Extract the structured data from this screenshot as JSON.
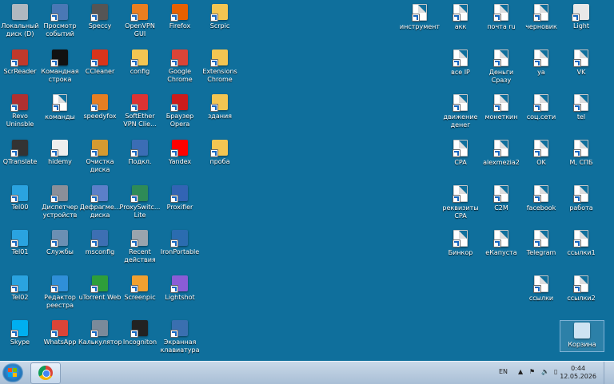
{
  "desktop": {
    "icons": [
      {
        "label": "Локальный диск (D)",
        "icon": "drive-icon",
        "color": "#b0b8c0"
      },
      {
        "label": "Просмотр событий",
        "icon": "event-viewer-icon",
        "color": "#4a78b5"
      },
      {
        "label": "Speccy",
        "icon": "speccy-icon",
        "color": "#555555"
      },
      {
        "label": "OpenVPN GUI",
        "icon": "openvpn-icon",
        "color": "#ea7e20"
      },
      {
        "label": "Firefox",
        "icon": "firefox-icon",
        "color": "#e66000"
      },
      {
        "label": "Scrpic",
        "icon": "folder-icon",
        "color": "#f3c552"
      },
      {
        "label": "ScrReader",
        "icon": "scrreader-icon",
        "color": "#c0392b"
      },
      {
        "label": "Командная строка",
        "icon": "cmd-icon",
        "color": "#111111"
      },
      {
        "label": "CCleaner",
        "icon": "ccleaner-icon",
        "color": "#d9341b"
      },
      {
        "label": "config",
        "icon": "folder-icon",
        "color": "#f3c552"
      },
      {
        "label": "Google Chrome",
        "icon": "chrome-icon",
        "color": "#db4437"
      },
      {
        "label": "Extensions Chrome",
        "icon": "folder-icon",
        "color": "#f3c552"
      },
      {
        "label": "Revo Uninsble",
        "icon": "revo-icon",
        "color": "#b03030"
      },
      {
        "label": "команды",
        "icon": "file-icon",
        "color": "#ffffff"
      },
      {
        "label": "speedyfox",
        "icon": "speedyfox-icon",
        "color": "#e67e22"
      },
      {
        "label": "SoftEther VPN Clie...",
        "icon": "softether-icon",
        "color": "#d33"
      },
      {
        "label": "Браузер Opera",
        "icon": "opera-icon",
        "color": "#cc1b1b"
      },
      {
        "label": "здания",
        "icon": "folder-icon",
        "color": "#f3c552"
      },
      {
        "label": "QTranslate",
        "icon": "qtranslate-icon",
        "color": "#333333"
      },
      {
        "label": "hidemy",
        "icon": "hidemy-icon",
        "color": "#eeeeee"
      },
      {
        "label": "Очистка диска",
        "icon": "disk-cleanup-icon",
        "color": "#d49a30"
      },
      {
        "label": "Подкл.",
        "icon": "network-icon",
        "color": "#3b6db5"
      },
      {
        "label": "Yandex",
        "icon": "yandex-icon",
        "color": "#ff0000"
      },
      {
        "label": "проба",
        "icon": "folder-icon",
        "color": "#f3c552"
      },
      {
        "label": "Tel00",
        "icon": "telegram-icon",
        "color": "#2aa3e0"
      },
      {
        "label": "Диспетчер устройств",
        "icon": "device-manager-icon",
        "color": "#8a8f99"
      },
      {
        "label": "Дефрагме... диска",
        "icon": "defrag-icon",
        "color": "#5b7fc9"
      },
      {
        "label": "ProxySwitc... Lite",
        "icon": "proxyswitcher-icon",
        "color": "#2e8b57"
      },
      {
        "label": "Proxifier",
        "icon": "proxifier-icon",
        "color": "#3264b4"
      },
      {
        "label": "Tel01",
        "icon": "telegram-icon",
        "color": "#2aa3e0"
      },
      {
        "label": "Службы",
        "icon": "gear-icon",
        "color": "#6b8fb3"
      },
      {
        "label": "msconfig",
        "icon": "msconfig-icon",
        "color": "#3d6fb3"
      },
      {
        "label": "Recent действия",
        "icon": "recent-icon",
        "color": "#9aa4ad"
      },
      {
        "label": "IronPortable",
        "icon": "iron-icon",
        "color": "#2b6cb0"
      },
      {
        "label": "Tel02",
        "icon": "telegram-icon",
        "color": "#2aa3e0"
      },
      {
        "label": "Редактор реестра",
        "icon": "regedit-icon",
        "color": "#2f8fd8"
      },
      {
        "label": "uTorrent Web",
        "icon": "utorrent-icon",
        "color": "#2e9e3a"
      },
      {
        "label": "Screenpic",
        "icon": "screenpic-icon",
        "color": "#f0a030"
      },
      {
        "label": "Lightshot",
        "icon": "lightshot-icon",
        "color": "#8a5cd6"
      },
      {
        "label": "Skype",
        "icon": "skype-icon",
        "color": "#00aff0"
      },
      {
        "label": "WhatsApp",
        "icon": "chrome-icon",
        "color": "#db4437"
      },
      {
        "label": "Калькулятор",
        "icon": "calculator-icon",
        "color": "#7a8a9a"
      },
      {
        "label": "Incogniton",
        "icon": "incogniton-icon",
        "color": "#222222"
      },
      {
        "label": "Экранная клавиатура",
        "icon": "keyboard-icon",
        "color": "#3a6fb0"
      },
      {
        "label": "инструмент",
        "icon": "file-icon",
        "color": "#ffffff"
      },
      {
        "label": "акк",
        "icon": "file-icon",
        "color": "#ffffff"
      },
      {
        "label": "почта ru",
        "icon": "file-icon",
        "color": "#ffffff"
      },
      {
        "label": "черновик",
        "icon": "file-icon",
        "color": "#ffffff"
      },
      {
        "label": "Light",
        "icon": "light-icon",
        "color": "#e8e8e8"
      },
      {
        "label": "все IP",
        "icon": "file-icon",
        "color": "#ffffff"
      },
      {
        "label": "Деньги Сразу",
        "icon": "file-icon",
        "color": "#ffffff"
      },
      {
        "label": "уа",
        "icon": "file-icon",
        "color": "#ffffff"
      },
      {
        "label": "VK",
        "icon": "file-icon",
        "color": "#ffffff"
      },
      {
        "label": "движение денег",
        "icon": "file-icon",
        "color": "#ffffff"
      },
      {
        "label": "монеткин",
        "icon": "file-icon",
        "color": "#ffffff"
      },
      {
        "label": "соц.сети",
        "icon": "file-icon",
        "color": "#ffffff"
      },
      {
        "label": "tel",
        "icon": "file-icon",
        "color": "#ffffff"
      },
      {
        "label": "CPA",
        "icon": "file-icon",
        "color": "#ffffff"
      },
      {
        "label": "alexmezia2",
        "icon": "file-icon",
        "color": "#ffffff"
      },
      {
        "label": "OK",
        "icon": "file-icon",
        "color": "#ffffff"
      },
      {
        "label": "М, СПБ",
        "icon": "file-icon",
        "color": "#ffffff"
      },
      {
        "label": "реквизиты CPA",
        "icon": "file-icon",
        "color": "#ffffff"
      },
      {
        "label": "C2M",
        "icon": "file-icon",
        "color": "#ffffff"
      },
      {
        "label": "facebook",
        "icon": "file-icon",
        "color": "#ffffff"
      },
      {
        "label": "работа",
        "icon": "file-icon",
        "color": "#ffffff"
      },
      {
        "label": "Бинкор",
        "icon": "file-icon",
        "color": "#ffffff"
      },
      {
        "label": "еКапуста",
        "icon": "file-icon",
        "color": "#ffffff"
      },
      {
        "label": "Telegram",
        "icon": "file-icon",
        "color": "#ffffff"
      },
      {
        "label": "ссылки1",
        "icon": "file-icon",
        "color": "#ffffff"
      },
      {
        "label": "ссылки",
        "icon": "file-icon",
        "color": "#ffffff"
      },
      {
        "label": "ссылки2",
        "icon": "file-icon",
        "color": "#ffffff"
      },
      {
        "label": "Корзина",
        "icon": "recycle-bin-icon",
        "color": "#cfe3f2"
      }
    ]
  },
  "taskbar": {
    "language": "EN",
    "time": "0:44",
    "date": "12.05.2026",
    "tray_up": "▲",
    "tray_flag": "⚑",
    "tray_speaker": "🔈",
    "tray_network": "▯"
  }
}
